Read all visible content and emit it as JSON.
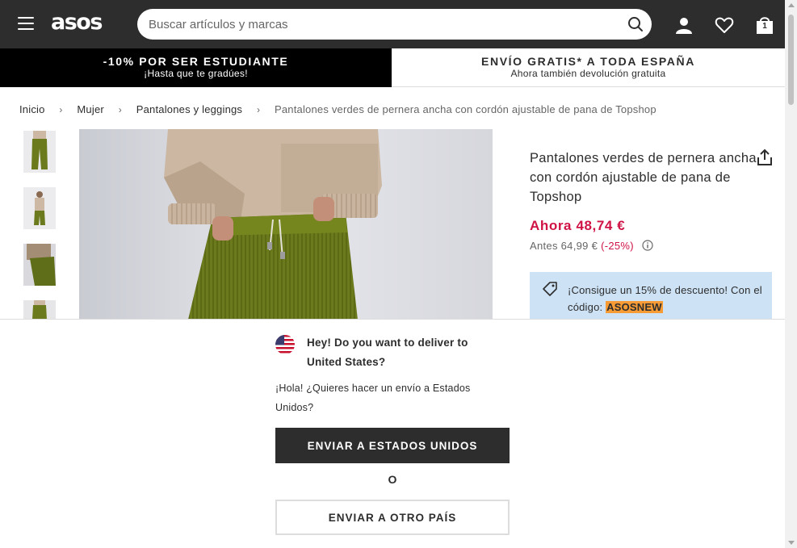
{
  "header": {
    "logo": "asos",
    "search_placeholder": "Buscar artículos y marcas",
    "bag_count": "1"
  },
  "promos": {
    "left_title": "-10% POR SER ESTUDIANTE",
    "left_sub": "¡Hasta que te gradúes!",
    "right_title": "ENVÍO GRATIS* A TODA ESPAÑA",
    "right_sub": "Ahora también devolución gratuita"
  },
  "breadcrumb": {
    "items": [
      "Inicio",
      "Mujer",
      "Pantalones y leggings"
    ],
    "current": "Pantalones verdes de pernera ancha con cordón ajustable de pana de Topshop",
    "separator": "›"
  },
  "product": {
    "title": "Pantalones verdes de pernera ancha con cordón ajustable de pana de Topshop",
    "price_now": "Ahora 48,74 €",
    "price_was": "Antes 64,99 €",
    "discount": "(-25%)",
    "promo_text": "¡Consigue un 15% de descuento! Con el código:",
    "promo_code": "ASOSNEW"
  },
  "overlay": {
    "title": "Hey! Do you want to deliver to United States?",
    "text": "¡Hola! ¿Quieres hacer un envío a Estados Unidos?",
    "primary_button": "ENVIAR A ESTADOS UNIDOS",
    "or": "O",
    "secondary_button": "ENVIAR A OTRO PAÍS"
  },
  "colors": {
    "header_bg": "#2d2d2d",
    "sale_red": "#d01345",
    "promo_blue": "#cde2f5",
    "code_orange": "#f79b34",
    "pants_green": "#6b7a1c"
  },
  "icons": {
    "menu": "hamburger-icon",
    "search": "search-icon",
    "account": "user-icon",
    "wishlist": "heart-icon",
    "bag": "bag-icon",
    "share": "share-icon",
    "info": "info-icon",
    "tag": "tag-icon",
    "flag": "us-flag-icon"
  }
}
